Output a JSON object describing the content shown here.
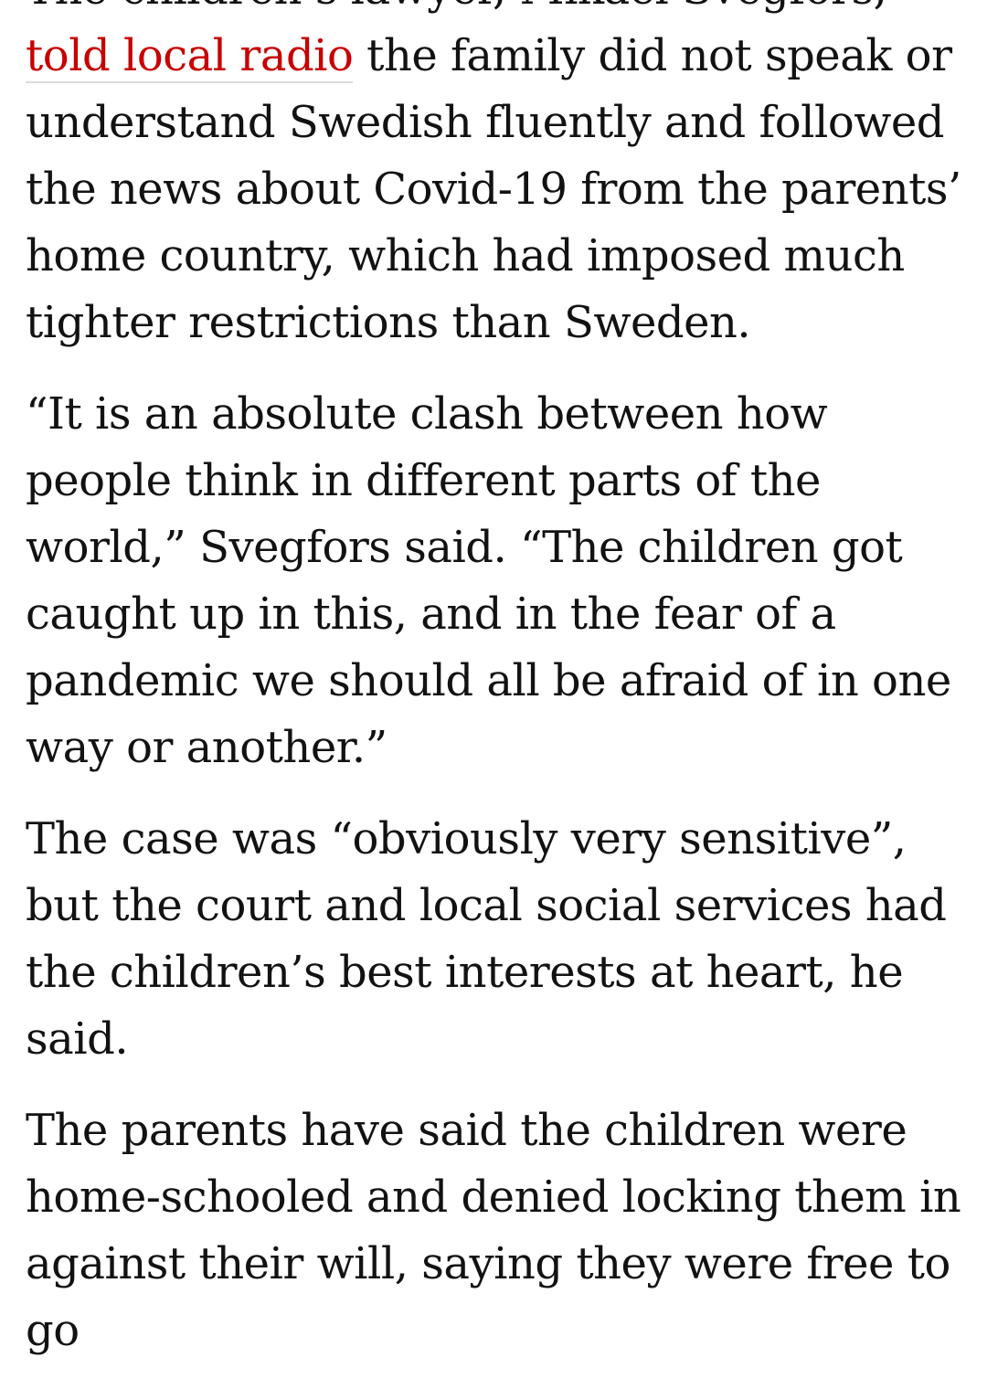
{
  "article": {
    "paragraphs": [
      {
        "before": "The children’s lawyer, Mikael Svegfors, ",
        "link": "told local radio",
        "after": " the family did not speak or understand Swedish fluently and followed the news about Covid-19 from the parents’ home country, which had imposed much tighter restrictions than Sweden."
      },
      {
        "text": "“It is an absolute clash between how people think in different parts of the world,” Svegfors said. “The children got caught up in this, and in the fear of a pandemic we should all be afraid of in one way or another.”"
      },
      {
        "text": "The case was “obviously very sensitive”, but the court and local social services had the children’s best interests at heart, he said."
      },
      {
        "text": "The parents have said the children were home-schooled and denied locking them in against their will, saying they were free to go"
      }
    ],
    "link_color": "#c70000",
    "text_color": "#121212"
  }
}
